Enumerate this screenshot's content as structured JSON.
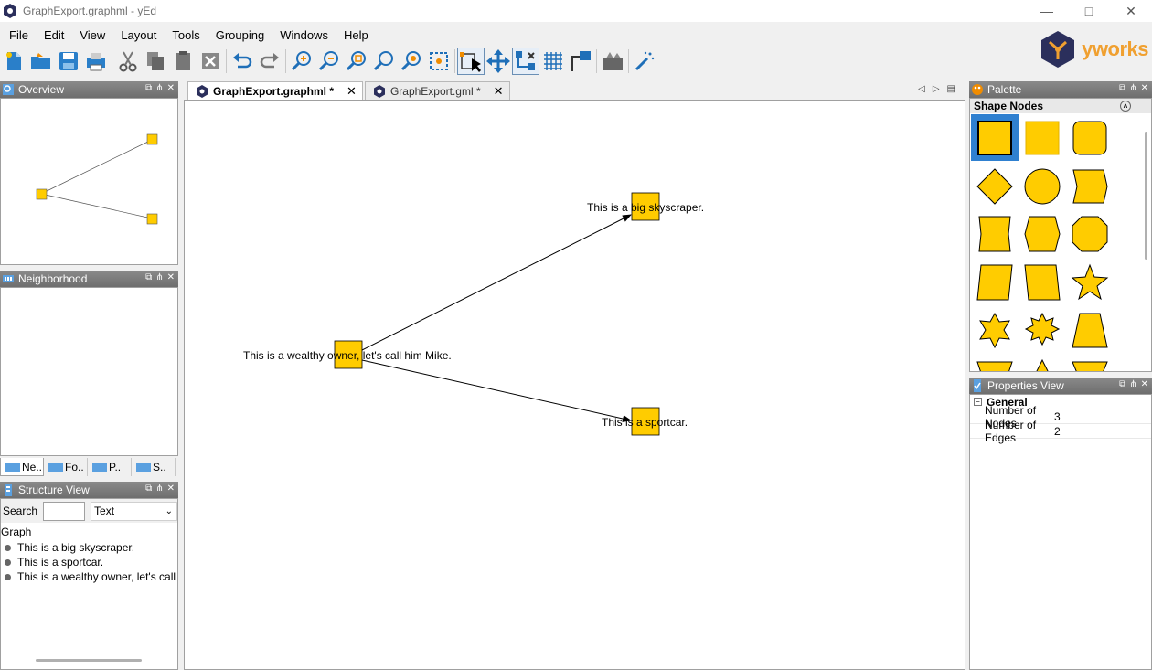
{
  "window": {
    "title": "GraphExport.graphml - yEd"
  },
  "menu": [
    "File",
    "Edit",
    "View",
    "Layout",
    "Tools",
    "Grouping",
    "Windows",
    "Help"
  ],
  "logo": {
    "name": "yworks"
  },
  "toolbar": {
    "icons": [
      "new-document-icon",
      "open-folder-icon",
      "save-icon",
      "print-icon",
      "cut-icon",
      "copy-icon",
      "paste-icon",
      "delete-icon",
      "undo-icon",
      "redo-icon",
      "zoom-in-icon",
      "zoom-out-icon",
      "zoom-fit-icon",
      "zoom-original-icon",
      "zoom-area-icon",
      "fit-content-icon",
      "edit-mode-icon",
      "move-mode-icon",
      "snap-icon",
      "grid-icon",
      "orthogonal-edge-icon",
      "fit-node-icon",
      "magic-wand-icon"
    ]
  },
  "overview": {
    "title": "Overview"
  },
  "neighborhood": {
    "title": "Neighborhood"
  },
  "left_tabs": [
    {
      "label": "Ne.."
    },
    {
      "label": "Fo.."
    },
    {
      "label": "P.."
    },
    {
      "label": "S.."
    }
  ],
  "structure": {
    "title": "Structure View",
    "search_label": "Search",
    "search_value": "",
    "filter_value": "Text",
    "root": "Graph",
    "items": [
      "This is a big skyscraper.",
      "This is a sportcar.",
      "This is a wealthy owner, let's call him Mike."
    ]
  },
  "doc_tabs": [
    {
      "label": "GraphExport.graphml *"
    },
    {
      "label": "GraphExport.gml *"
    }
  ],
  "graph": {
    "node_color": "#ffcc00",
    "nodes": [
      {
        "id": "owner",
        "label": "This is a wealthy owner, let's call him Mike."
      },
      {
        "id": "skyscraper",
        "label": "This is a big skyscraper."
      },
      {
        "id": "sportcar",
        "label": "This is a sportcar."
      }
    ],
    "edges": [
      {
        "from": "owner",
        "to": "skyscraper"
      },
      {
        "from": "owner",
        "to": "sportcar"
      }
    ]
  },
  "palette": {
    "title": "Palette",
    "section": "Shape Nodes",
    "shape_color": "#ffcc00"
  },
  "properties": {
    "title": "Properties View",
    "group": "General",
    "rows": [
      {
        "key": "Number of Nodes",
        "value": "3"
      },
      {
        "key": "Number of Edges",
        "value": "2"
      }
    ]
  }
}
